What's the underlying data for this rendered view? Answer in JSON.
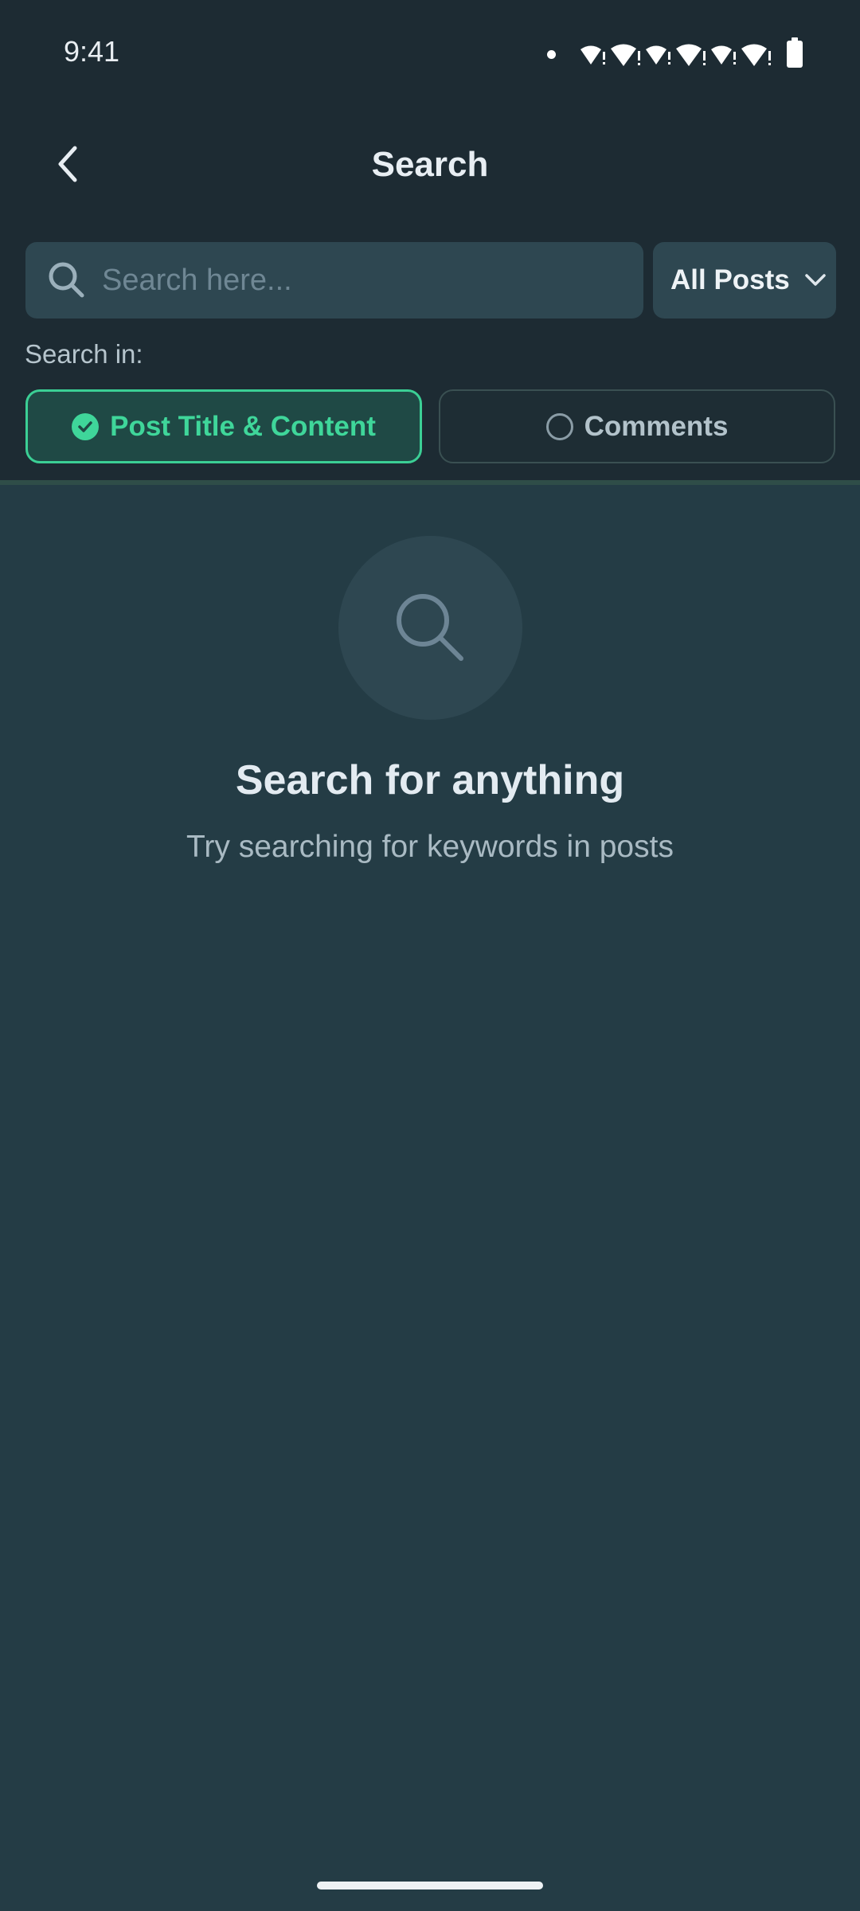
{
  "status_bar": {
    "time": "9:41",
    "icons": [
      "notification-dot-icon",
      "wifi-icon",
      "wifi-icon",
      "wifi-icon",
      "wifi-icon",
      "wifi-icon",
      "wifi-icon",
      "battery-icon"
    ]
  },
  "header": {
    "title": "Search",
    "back_icon": "chevron-left-icon"
  },
  "search": {
    "value": "",
    "placeholder": "Search here...",
    "icon": "search-icon"
  },
  "filter": {
    "selected": "All Posts",
    "icon": "chevron-down-icon"
  },
  "search_in": {
    "label": "Search in:",
    "options": [
      {
        "label": "Post Title & Content",
        "selected": true,
        "icon": "check-circle-icon"
      },
      {
        "label": "Comments",
        "selected": false,
        "icon": "radio-empty-icon"
      }
    ]
  },
  "empty_state": {
    "icon": "search-icon",
    "title": "Search for anything",
    "subtitle": "Try searching for keywords in posts"
  },
  "colors": {
    "background": "#243c45",
    "header_background": "#1d2b33",
    "surface": "#2e4751",
    "accent": "#3fd69a",
    "text_primary": "#e8eef3",
    "text_secondary": "#a9bac3"
  }
}
